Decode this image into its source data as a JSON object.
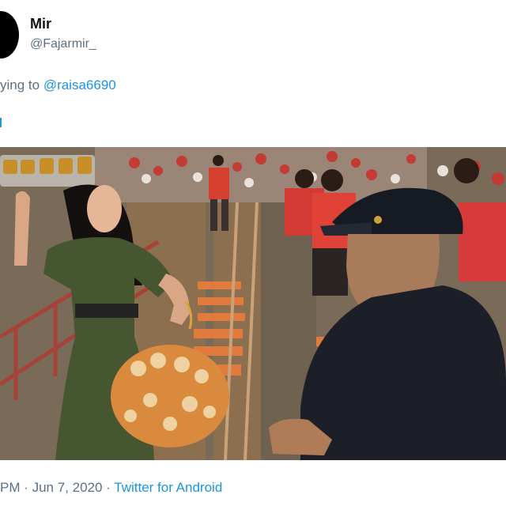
{
  "tweet": {
    "display_name": "Mir",
    "handle": "@Fajarmir_",
    "reply_prefix": "ying to ",
    "reply_mention": "@raisa6690",
    "time_fragment": "PM · Jun 7, 2020 · ",
    "source": "Twitter for Android"
  },
  "icons": [
    "avatar-image"
  ],
  "colors": {
    "accent": "#1b95e0",
    "secondary_text": "#5b7083"
  }
}
